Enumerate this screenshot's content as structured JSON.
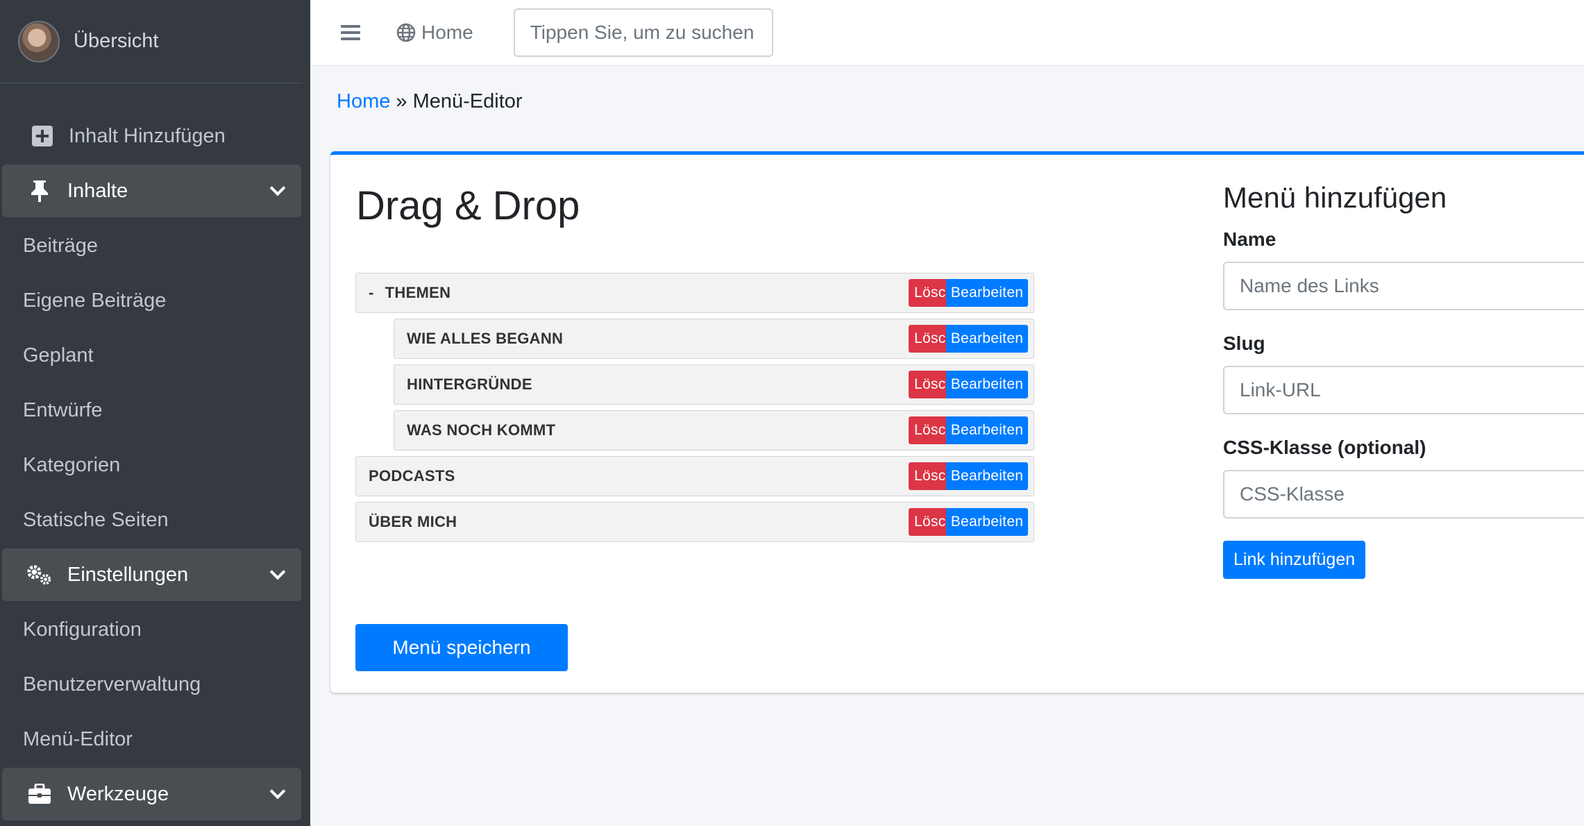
{
  "sidebar": {
    "brand": "Übersicht",
    "add_content": "Inhalt Hinzufügen",
    "content_section": "Inhalte",
    "content_items": [
      "Beiträge",
      "Eigene Beiträge",
      "Geplant",
      "Entwürfe",
      "Kategorien",
      "Statische Seiten"
    ],
    "settings_section": "Einstellungen",
    "settings_items": [
      "Konfiguration",
      "Benutzerverwaltung",
      "Menü-Editor"
    ],
    "tools_section": "Werkzeuge"
  },
  "topbar": {
    "home": "Home",
    "search_placeholder": "Tippen Sie, um zu suchen"
  },
  "breadcrumb": {
    "home": "Home",
    "separator": " » ",
    "current": "Menü-Editor"
  },
  "editor": {
    "title": "Drag & Drop",
    "collapse_symbol": "-",
    "delete_label": "Löschen",
    "edit_label": "Bearbeiten",
    "items": [
      {
        "label": "THEMEN"
      },
      {
        "label": "WIE ALLES BEGANN"
      },
      {
        "label": "HINTERGRÜNDE"
      },
      {
        "label": "WAS NOCH KOMMT"
      },
      {
        "label": "PODCASTS"
      },
      {
        "label": "ÜBER MICH"
      }
    ],
    "save_label": "Menü speichern"
  },
  "form": {
    "title": "Menü hinzufügen",
    "name_label": "Name",
    "name_placeholder": "Name des Links",
    "slug_label": "Slug",
    "slug_placeholder": "Link-URL",
    "css_label": "CSS-Klasse (optional)",
    "css_placeholder": "CSS-Klasse",
    "add_label": "Link hinzufügen"
  },
  "colors": {
    "sidebar_bg": "#343a40",
    "primary": "#007bff",
    "danger": "#dc3545"
  }
}
